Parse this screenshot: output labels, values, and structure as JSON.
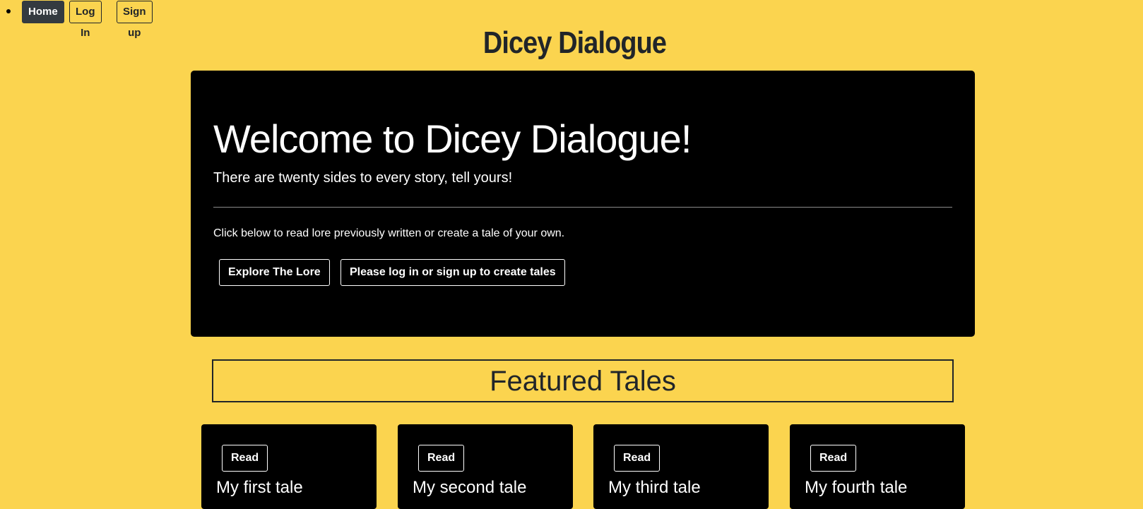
{
  "nav": {
    "home_label": "Home",
    "login_label": "Log In",
    "signup_label": "Sign up"
  },
  "site_title": "Dicey Dialogue",
  "hero": {
    "heading": "Welcome to Dicey Dialogue!",
    "lead": "There are twenty sides to every story, tell yours!",
    "text": "Click below to read lore previously written or create a tale of your own.",
    "explore_label": "Explore The Lore",
    "create_label": "Please log in or sign up to create tales"
  },
  "featured": {
    "heading": "Featured Tales",
    "cards": [
      {
        "read_label": "Read",
        "title": "My first tale"
      },
      {
        "read_label": "Read",
        "title": "My second tale"
      },
      {
        "read_label": "Read",
        "title": "My third tale"
      },
      {
        "read_label": "Read",
        "title": "My fourth tale"
      }
    ]
  },
  "colors": {
    "background": "#fbd44f",
    "panel": "#000000",
    "nav_active": "#343a40",
    "text_dark": "#212529"
  }
}
